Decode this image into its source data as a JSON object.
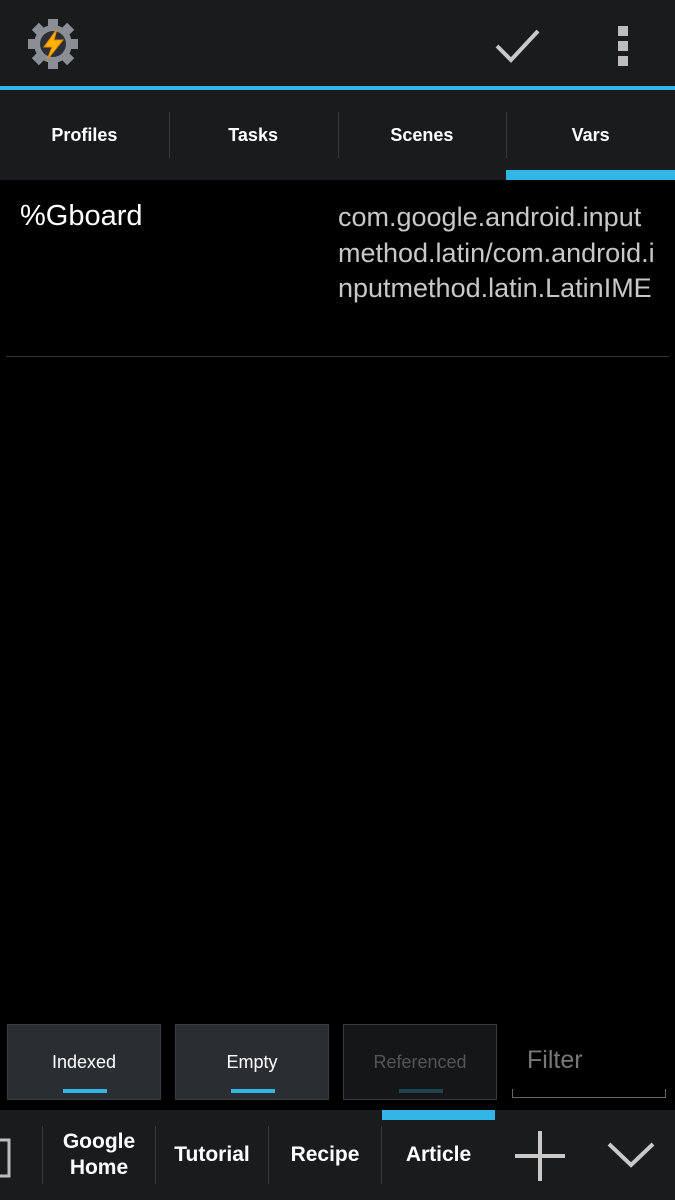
{
  "header": {
    "app_icon": "tasker-gear-icon",
    "confirm_icon": "check-icon",
    "menu_icon": "overflow-menu-icon",
    "accent_color": "#33b5e5"
  },
  "tabs": [
    {
      "label": "Profiles",
      "active": false
    },
    {
      "label": "Tasks",
      "active": false
    },
    {
      "label": "Scenes",
      "active": false
    },
    {
      "label": "Vars",
      "active": true
    }
  ],
  "variables": [
    {
      "name": "%Gboard",
      "value": "com.google.android.inputmethod.latin/com.android.inputmethod.latin.LatinIME"
    }
  ],
  "filters": {
    "indexed": "Indexed",
    "empty": "Empty",
    "referenced": "Referenced",
    "filter_placeholder": "Filter"
  },
  "projects": [
    {
      "label": "Google Home",
      "active": false
    },
    {
      "label": "Tutorial",
      "active": false
    },
    {
      "label": "Recipe",
      "active": false
    },
    {
      "label": "Article",
      "active": true
    }
  ],
  "bottom_icons": {
    "add": "plus-icon",
    "expand": "chevron-down-icon",
    "image": "image-icon"
  }
}
